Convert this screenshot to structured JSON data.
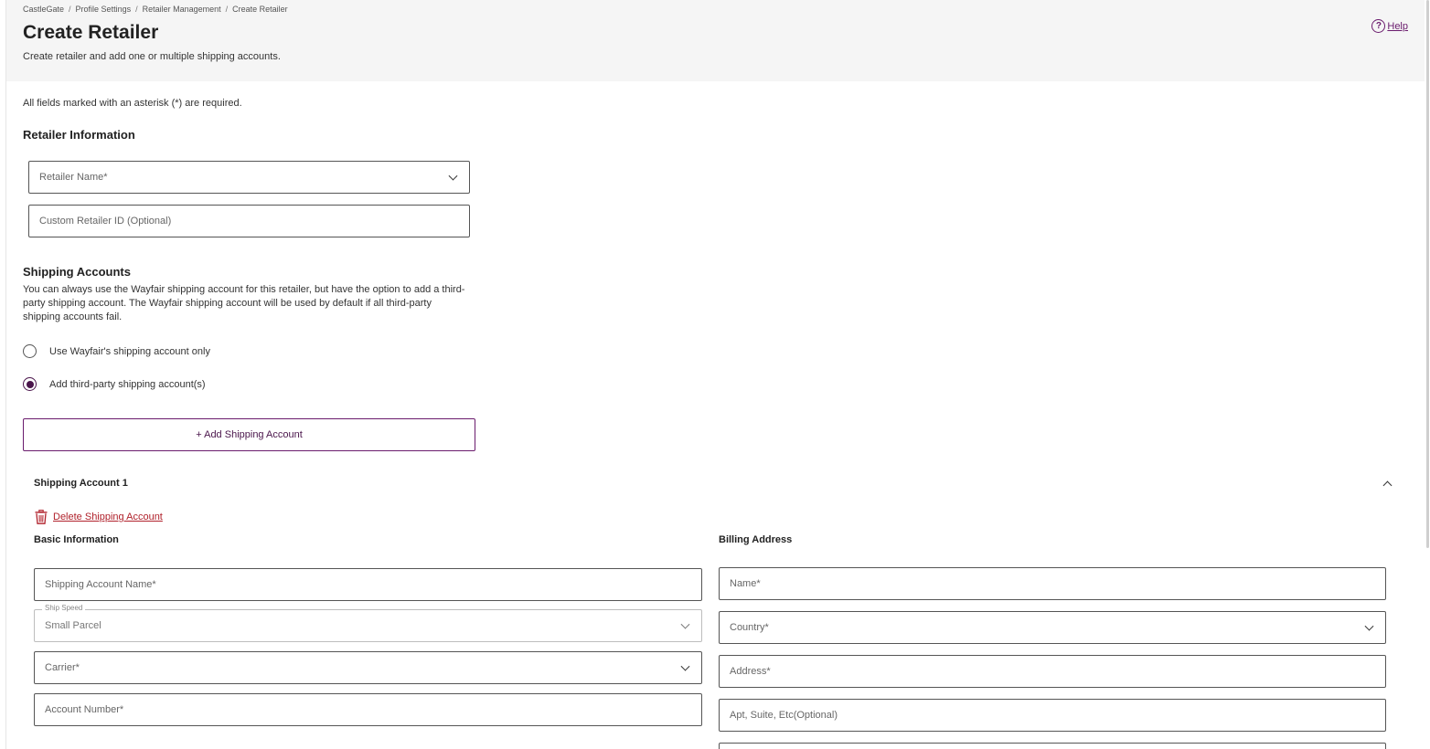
{
  "breadcrumb": [
    "CastleGate",
    "Profile Settings",
    "Retailer Management",
    "Create Retailer"
  ],
  "page": {
    "title": "Create Retailer",
    "subtitle": "Create retailer and add one or multiple shipping accounts.",
    "help_label": "Help",
    "help_glyph": "?"
  },
  "required_note": "All fields marked with an asterisk (*) are required.",
  "retailer_info": {
    "title": "Retailer Information",
    "retailer_name_placeholder": "Retailer Name*",
    "custom_id_placeholder": "Custom Retailer ID (Optional)"
  },
  "shipping": {
    "title": "Shipping Accounts",
    "description": "You can always use the Wayfair shipping account for this retailer, but have the option to add a third-party shipping account. The Wayfair shipping account will be used by default if all third-party shipping accounts fail.",
    "options": [
      {
        "label": "Use Wayfair's shipping account only",
        "checked": false
      },
      {
        "label": "Add third-party shipping account(s)",
        "checked": true
      }
    ],
    "add_button": "+ Add Shipping Account"
  },
  "account": {
    "title": "Shipping Account 1",
    "delete_label": "Delete Shipping Account",
    "basic_info": {
      "title": "Basic Information",
      "name_placeholder": "Shipping Account Name*",
      "ship_speed_label": "Ship Speed",
      "ship_speed_value": "Small Parcel",
      "carrier_placeholder": "Carrier*",
      "account_number_placeholder": "Account Number*"
    },
    "billing": {
      "title": "Billing Address",
      "name_placeholder": "Name*",
      "country_placeholder": "Country*",
      "address_placeholder": "Address*",
      "apt_placeholder": "Apt, Suite, Etc(Optional)"
    }
  },
  "colors": {
    "accent": "#4a154b",
    "link": "#6a1b6d",
    "danger": "#b0212b",
    "header_bg": "#f5f5f5"
  },
  "icons": {
    "help": "help-circle-icon",
    "delete": "trash-icon",
    "dropdown": "chevron-down-icon",
    "collapse": "chevron-up-icon"
  }
}
